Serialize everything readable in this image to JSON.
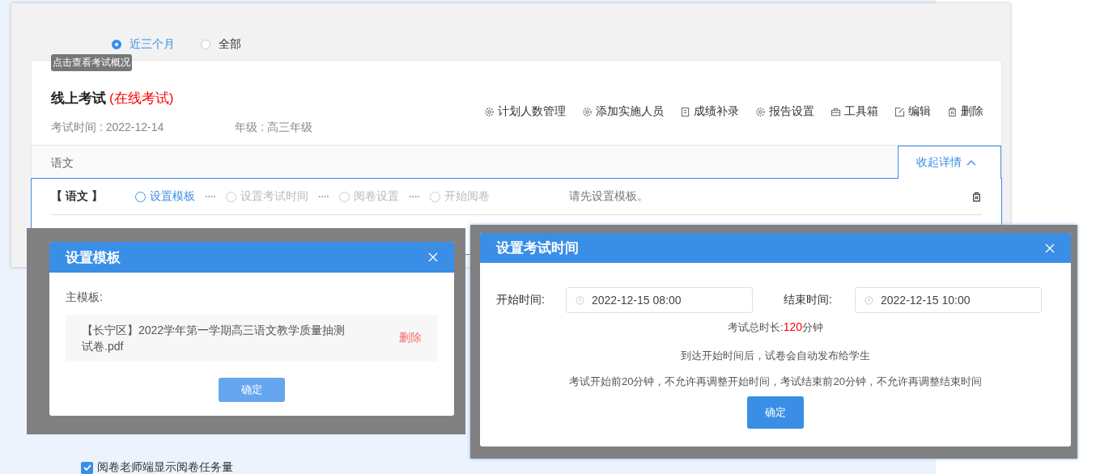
{
  "filter": [
    {
      "label": "近三个月",
      "selected": true
    },
    {
      "label": "全部",
      "selected": false
    }
  ],
  "tooltip": "点击查看考试概况",
  "exam": {
    "title": "线上考试",
    "type": "(在线考试)",
    "date": "考试时间 : 2022-12-14",
    "grade": "年级 : 高三年级"
  },
  "actions": [
    {
      "label": "计划人数管理",
      "kind": "gear"
    },
    {
      "label": "添加实施人员",
      "kind": "gear"
    },
    {
      "label": "成绩补录",
      "kind": "note"
    },
    {
      "label": "报告设置",
      "kind": "gear"
    },
    {
      "label": "工具箱",
      "kind": "toolbox"
    },
    {
      "label": "编辑",
      "kind": "edit"
    },
    {
      "label": "删除",
      "kind": "trash"
    }
  ],
  "subject_tab": "语文",
  "collapse": "收起详情",
  "subject_row": {
    "name": "【 语文 】",
    "steps": [
      {
        "label": "设置模板",
        "selected": true
      },
      {
        "label": "设置考试时间",
        "selected": false
      },
      {
        "label": "阅卷设置",
        "selected": false
      },
      {
        "label": "开始阅卷",
        "selected": false
      }
    ],
    "hint": "请先设置模板。"
  },
  "template_dialog": {
    "title": "设置模板",
    "label": "主模板:",
    "file": "【长宁区】2022学年第一学期高三语文教学质量抽测试卷.pdf",
    "delete": "删除",
    "ok": "确定"
  },
  "time_dialog": {
    "title": "设置考试时间",
    "start_label": "开始时间:",
    "start": "2022-12-15 08:00",
    "end_label": "结束时间:",
    "end": "2022-12-15 10:00",
    "duration_label": "考试总时长:",
    "duration_value": "120",
    "duration_unit": "分钟",
    "notes": [
      "到达开始时间后，试卷会自动发布给学生",
      "考试开始前20分钟，不允许再调整开始时间，考试结束前20分钟，不允许再调整结束时间"
    ],
    "ok": "确定"
  },
  "checkbox": {
    "label": "阅卷老师端显示阅卷任务量",
    "checked": true
  }
}
